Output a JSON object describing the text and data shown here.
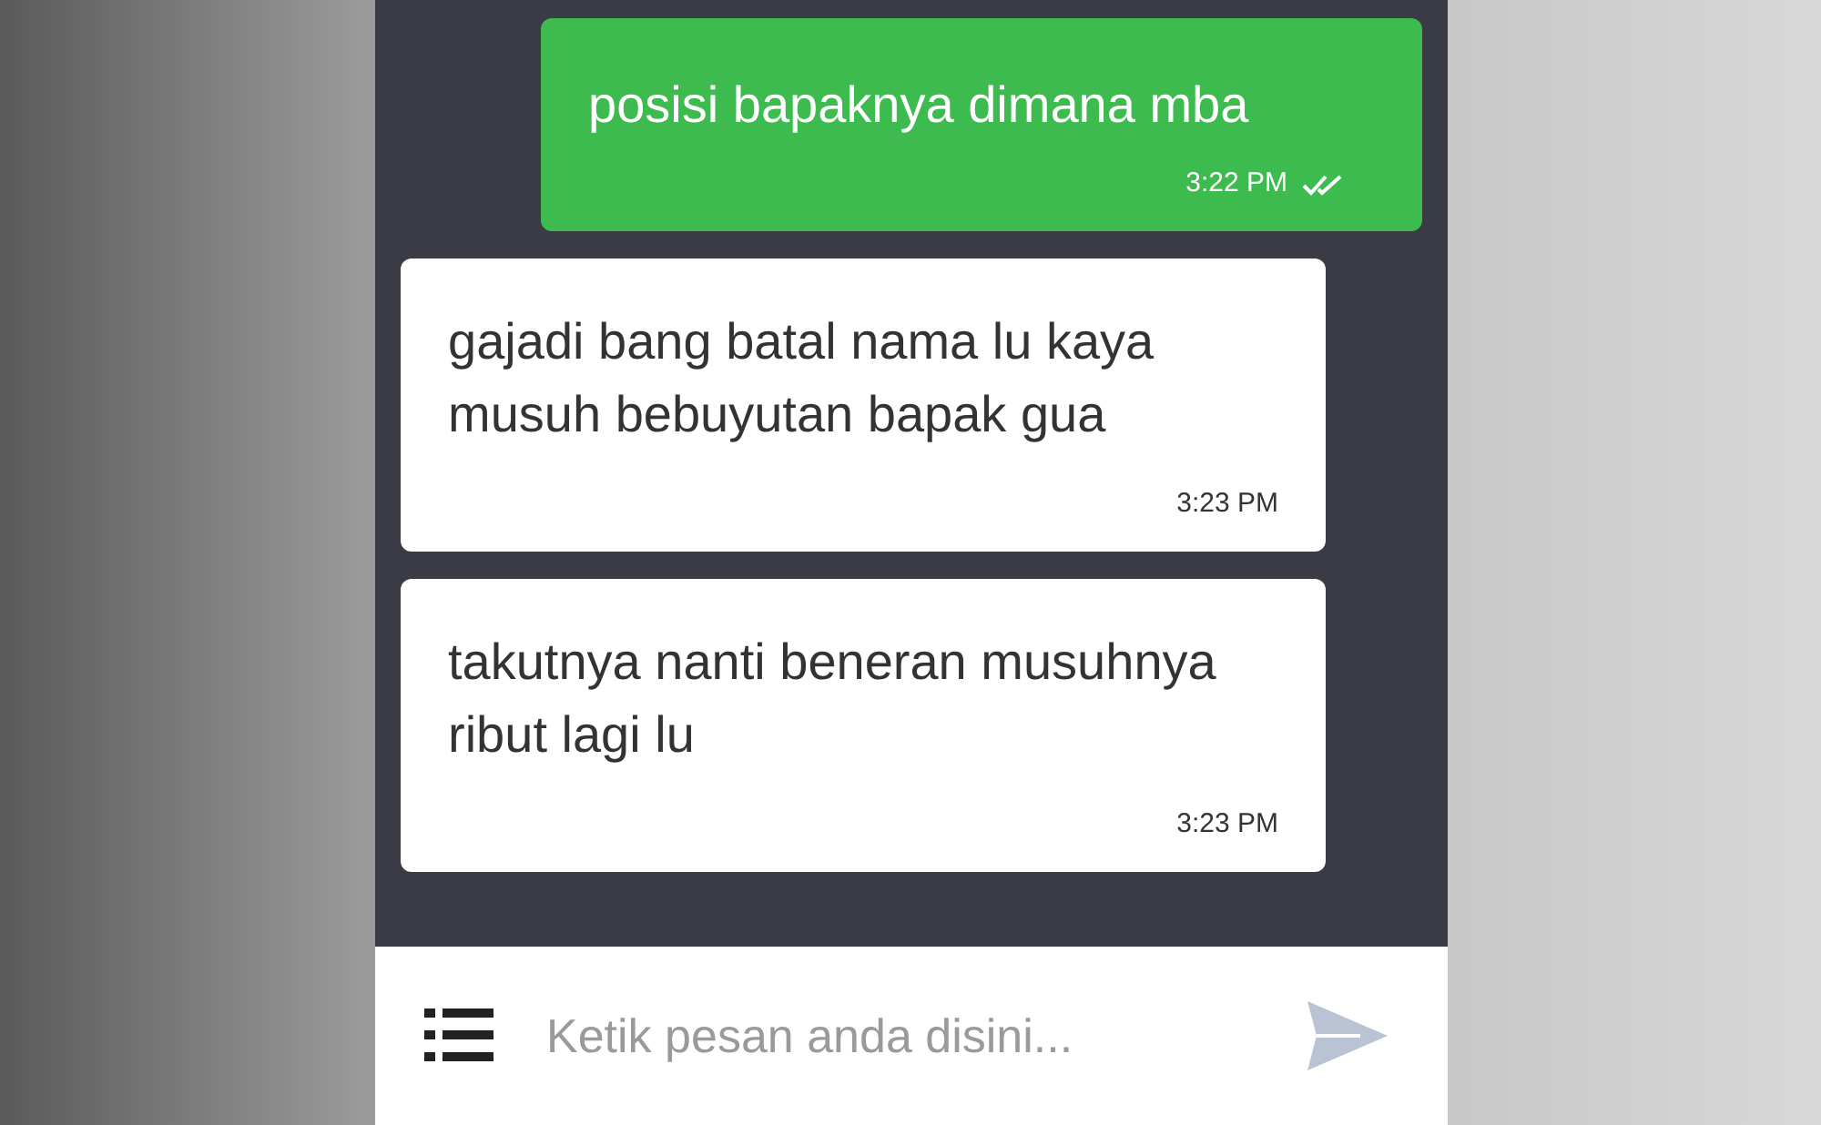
{
  "messages": [
    {
      "kind": "sent",
      "text": "posisi bapaknya dimana mba",
      "time": "3:22 PM",
      "read": true
    },
    {
      "kind": "received",
      "text": "gajadi bang batal nama lu kaya musuh bebuyutan bapak gua",
      "time": "3:23 PM"
    },
    {
      "kind": "received",
      "text": "takutnya nanti beneran musuhnya ribut lagi lu",
      "time": "3:23 PM"
    }
  ],
  "composer": {
    "placeholder": "Ketik pesan anda disini..."
  }
}
